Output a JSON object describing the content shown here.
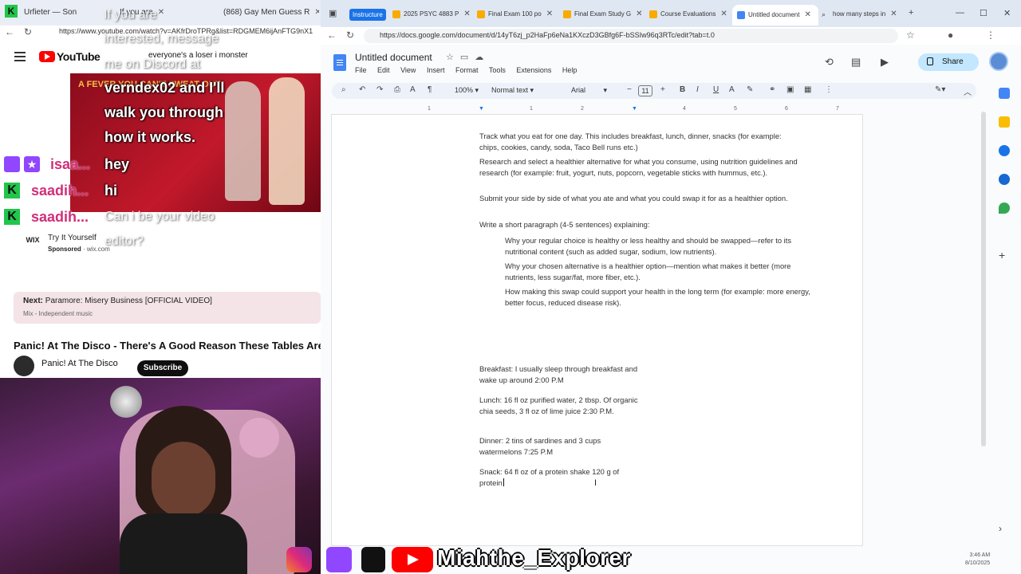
{
  "left_browser": {
    "tabs": [
      {
        "label": "Urfieter — Son"
      },
      {
        "label": "If you are"
      },
      {
        "label": "(868) Gay Men Guess R"
      }
    ],
    "url": "https://www.youtube.com/watch?v=AKfrDroTPRg&list=RDGMEM6ijAnFTG9nX1",
    "youtube_logo": "YouTube",
    "search_text": "everyone's a loser i monster",
    "stream_overlay_text": "A FEVER YOU CAN'T SWEAT OUT",
    "chat": [
      {
        "name": "",
        "text": "If you are",
        "style": "ghost"
      },
      {
        "name": "",
        "text": "interested, message",
        "style": "ghost"
      },
      {
        "name": "",
        "text": "me on Discord at",
        "style": "ghost"
      },
      {
        "name": "",
        "text": "verndex02 and I'll",
        "style": "white"
      },
      {
        "name": "",
        "text": "walk you through",
        "style": "white"
      },
      {
        "name": "",
        "text": "how it works.",
        "style": "white"
      },
      {
        "name": "isaa...",
        "text": "hey",
        "style": "white"
      },
      {
        "name": "saadih...",
        "text": "hi",
        "style": "white"
      },
      {
        "name": "saadih...",
        "text": "Can i be your video",
        "style": "ghost"
      },
      {
        "name": "",
        "text": "editor?",
        "style": "ghost"
      }
    ],
    "ad": {
      "logo": "WIX",
      "title": "Try It Yourself",
      "sponsored": "Sponsored",
      "domain": "wix.com"
    },
    "next_up": {
      "label": "Next:",
      "title": "Paramore: Misery Business [OFFICIAL VIDEO]",
      "sub": "Mix - Independent music"
    },
    "video_title": "Panic! At The Disco - There's A Good Reason These Tables Are N",
    "channel_name": "Panic! At The Disco",
    "subscribe": "Subscribe"
  },
  "social": {
    "handle": "Miahthe_Explorer"
  },
  "right_browser": {
    "tabs": [
      {
        "label": "2025 PSYC 4883 P",
        "active": false
      },
      {
        "label": "Final Exam 100 po",
        "active": false
      },
      {
        "label": "Final Exam Study G",
        "active": false
      },
      {
        "label": "Course Evaluations",
        "active": false
      },
      {
        "label": "Untitled document",
        "active": true
      },
      {
        "label": "how many steps in",
        "active": false
      }
    ],
    "instructure_label": "Instructure",
    "url": "https://docs.google.com/document/d/14yT6zj_p2HaFp6eNa1KXczD3GBfg6F-bSSIw96q3RTc/edit?tab=t.0"
  },
  "doc": {
    "title": "Untitled document",
    "menu": [
      "File",
      "Edit",
      "View",
      "Insert",
      "Format",
      "Tools",
      "Extensions",
      "Help"
    ],
    "share_label": "Share",
    "toolbar": {
      "zoom": "100%",
      "style": "Normal text",
      "font": "Arial",
      "size": "11"
    },
    "ruler": [
      "1",
      "1",
      "2",
      "3",
      "4",
      "5",
      "6",
      "7"
    ],
    "paragraphs": [
      "Track what you eat for one day. This includes breakfast, lunch, dinner, snacks (for example: chips, cookies, candy, soda, Taco Bell runs etc.)",
      "Research and select a healthier alternative for what you consume, using nutrition guidelines and research (for example: fruit, yogurt, nuts, popcorn, vegetable sticks with hummus, etc.).",
      "Submit your side by side of what you ate and what you could swap it for as a healthier option.",
      "Write a short paragraph (4-5 sentences) explaining:"
    ],
    "bullets": [
      "Why your regular choice is healthy or less healthy and should be swapped—refer to its nutritional content (such as added sugar, sodium, low nutrients).",
      "Why your chosen alternative is a healthier option—mention what makes it better (more nutrients, less sugar/fat, more fiber, etc.).",
      "How making this swap could support your health in the long term (for example: more energy, better focus, reduced disease risk)."
    ],
    "log": {
      "breakfast": "Breakfast: I usually sleep through breakfast and wake up around 2:00 P.M",
      "lunch": "Lunch: 16 fl oz  purified water, 2 tbsp. Of organic chia seeds, 3 fl oz of lime juice 2:30 P.M.",
      "dinner": "Dinner: 2 tins of sardines and 3 cups watermelons 7:25 P.M",
      "snack": "Snack: 64 fl oz of a protein shake 120 g of protein"
    }
  },
  "clock": {
    "time": "3:46 AM",
    "date": "8/10/2025"
  }
}
